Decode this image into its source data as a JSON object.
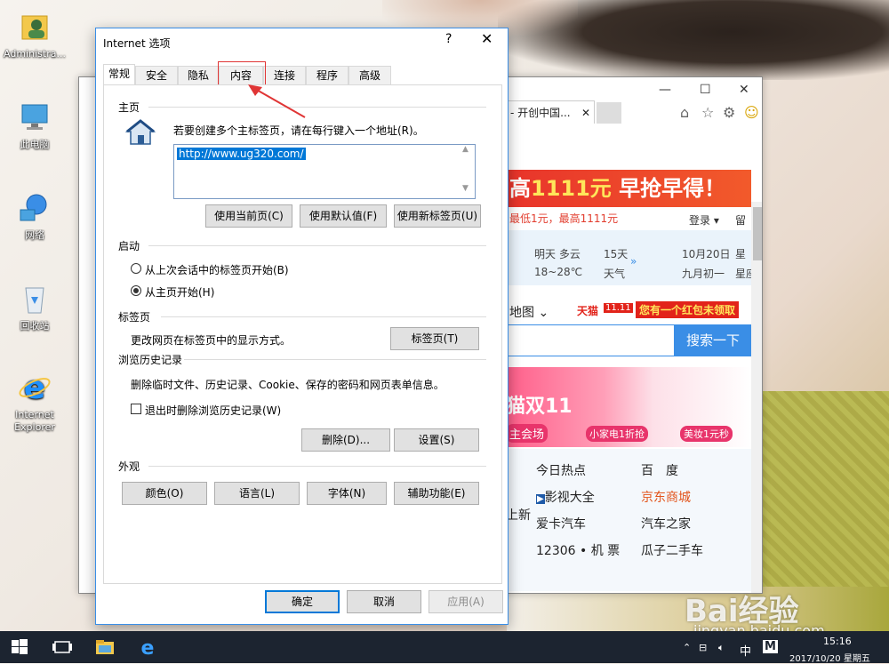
{
  "desktop": {
    "icons": [
      {
        "label": "Administra...",
        "icon": "user-folder-icon"
      },
      {
        "label": "此电脑",
        "icon": "computer-icon"
      },
      {
        "label": "网络",
        "icon": "network-icon"
      },
      {
        "label": "回收站",
        "icon": "recycle-bin-icon"
      },
      {
        "label": "Internet Explorer",
        "icon": "internet-explorer-icon"
      }
    ]
  },
  "ie_window": {
    "tab_title": "- 开创中国...",
    "banner": {
      "prefix": "高",
      "amount": "1111元",
      "suffix": " 早抢早得！"
    },
    "subbanner": "最低1元，最高1111元",
    "login": "登录",
    "leave": "留",
    "weather": {
      "day1": "明天 多云",
      "day1_temp": "18~28℃",
      "day2": "15天",
      "day2_sub": "天气",
      "date": "10月20日",
      "lunar": "九月初一",
      "week1": "星",
      "week2": "星座"
    },
    "tmall": {
      "map": "地图",
      "tmall": "天猫",
      "badge": "11.11",
      "redpack": "您有一个红包未领取"
    },
    "search_button": "搜索一下",
    "promo": {
      "double11": "猫双11",
      "venue": "主会场",
      "appliance": "小家电1折抢",
      "beauty": "美妆1元秒"
    },
    "sites": [
      {
        "text": "今日热点",
        "red": false
      },
      {
        "text": "百　度",
        "red": false
      },
      {
        "text": "影视大全",
        "red": false
      },
      {
        "text": "京东商城",
        "red": true
      },
      {
        "text": "爱卡汽车",
        "red": false
      },
      {
        "text": "汽车之家",
        "red": false
      },
      {
        "text": "12306 • 机 票",
        "red": false
      },
      {
        "text": "瓜子二手车",
        "red": false
      }
    ],
    "sites_left_fragment": "上新"
  },
  "dialog": {
    "title": "Internet 选项",
    "help": "?",
    "close": "✕",
    "tabs": [
      "常规",
      "安全",
      "隐私",
      "内容",
      "连接",
      "程序",
      "高级"
    ],
    "active_tab": "常规",
    "home": {
      "section": "主页",
      "hint": "若要创建多个主标签页，请在每行键入一个地址(R)。",
      "url": "http://www.ug320.com/",
      "buttons": [
        "使用当前页(C)",
        "使用默认值(F)",
        "使用新标签页(U)"
      ]
    },
    "startup": {
      "section": "启动",
      "option1": "从上次会话中的标签页开始(B)",
      "option2": "从主页开始(H)",
      "selected": "从主页开始(H)"
    },
    "tabs_section": {
      "section": "标签页",
      "desc": "更改网页在标签页中的显示方式。",
      "button": "标签页(T)"
    },
    "history": {
      "section": "浏览历史记录",
      "desc": "删除临时文件、历史记录、Cookie、保存的密码和网页表单信息。",
      "checkbox": "退出时删除浏览历史记录(W)",
      "delete_button": "删除(D)...",
      "settings_button": "设置(S)"
    },
    "appearance": {
      "section": "外观",
      "buttons": [
        "颜色(O)",
        "语言(L)",
        "字体(N)",
        "辅助功能(E)"
      ]
    },
    "footer": {
      "ok": "确定",
      "cancel": "取消",
      "apply": "应用(A)"
    }
  },
  "taskbar": {
    "time": "15:16",
    "date": "2017/10/20 星期五",
    "ime": "中",
    "ime_mode": "M"
  },
  "watermark": {
    "brand": "Bai经验",
    "url": "jingyan.baidu.com"
  },
  "colors": {
    "accent": "#0078d7",
    "highlight_box": "#e03535",
    "banner": "#e8342b"
  }
}
